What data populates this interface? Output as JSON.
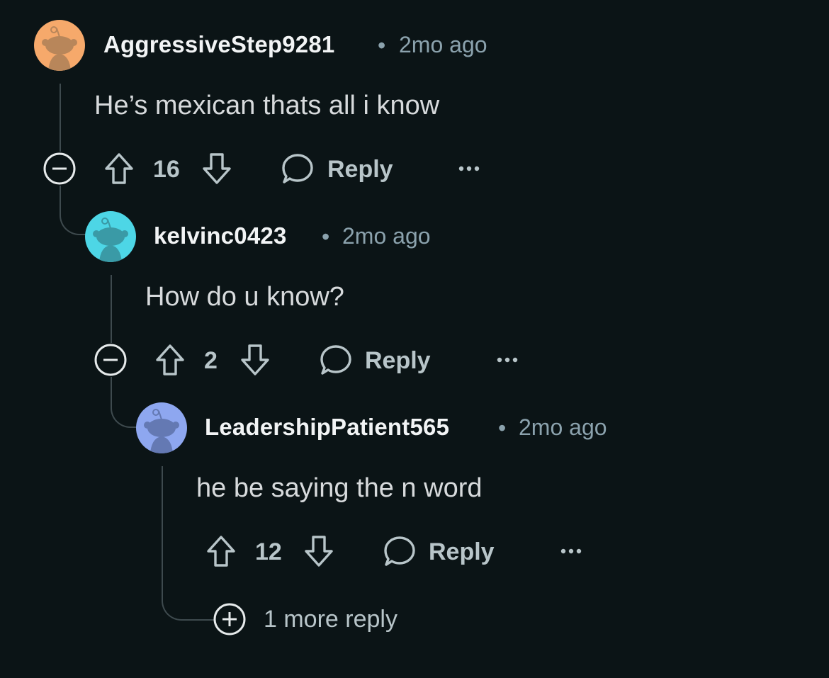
{
  "comments": [
    {
      "username": "AggressiveStep9281",
      "separator": "•",
      "timestamp": "2mo ago",
      "text": "He’s mexican thats all i know",
      "score": "16",
      "reply_label": "Reply",
      "avatar_color": "#f6a96b",
      "avatar_fg": "#b8865a"
    },
    {
      "username": "kelvinc0423",
      "separator": "•",
      "timestamp": "2mo ago",
      "text": "How do u know?",
      "score": "2",
      "reply_label": "Reply",
      "avatar_color": "#4dd6e6",
      "avatar_fg": "#3a9aa6"
    },
    {
      "username": "LeadershipPatient565",
      "separator": "•",
      "timestamp": "2mo ago",
      "text": "he be saying the n word",
      "score": "12",
      "reply_label": "Reply",
      "avatar_color": "#8ea7f0",
      "avatar_fg": "#6479b3"
    }
  ],
  "more_replies_label": "1 more reply",
  "icons": {
    "collapse": "minus-circle-icon",
    "expand": "plus-circle-icon",
    "upvote": "arrow-up-icon",
    "downvote": "arrow-down-icon",
    "reply": "speech-bubble-icon",
    "more": "ellipsis-icon"
  }
}
